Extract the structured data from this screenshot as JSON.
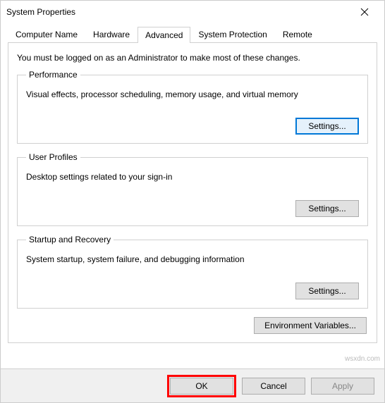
{
  "window": {
    "title": "System Properties"
  },
  "tabs": {
    "computer_name": "Computer Name",
    "hardware": "Hardware",
    "advanced": "Advanced",
    "system_protection": "System Protection",
    "remote": "Remote"
  },
  "notice": "You must be logged on as an Administrator to make most of these changes.",
  "groups": {
    "performance": {
      "legend": "Performance",
      "desc": "Visual effects, processor scheduling, memory usage, and virtual memory",
      "button": "Settings..."
    },
    "user_profiles": {
      "legend": "User Profiles",
      "desc": "Desktop settings related to your sign-in",
      "button": "Settings..."
    },
    "startup_recovery": {
      "legend": "Startup and Recovery",
      "desc": "System startup, system failure, and debugging information",
      "button": "Settings..."
    }
  },
  "env_button": "Environment Variables...",
  "footer": {
    "ok": "OK",
    "cancel": "Cancel",
    "apply": "Apply"
  },
  "watermark": "wsxdn.com"
}
